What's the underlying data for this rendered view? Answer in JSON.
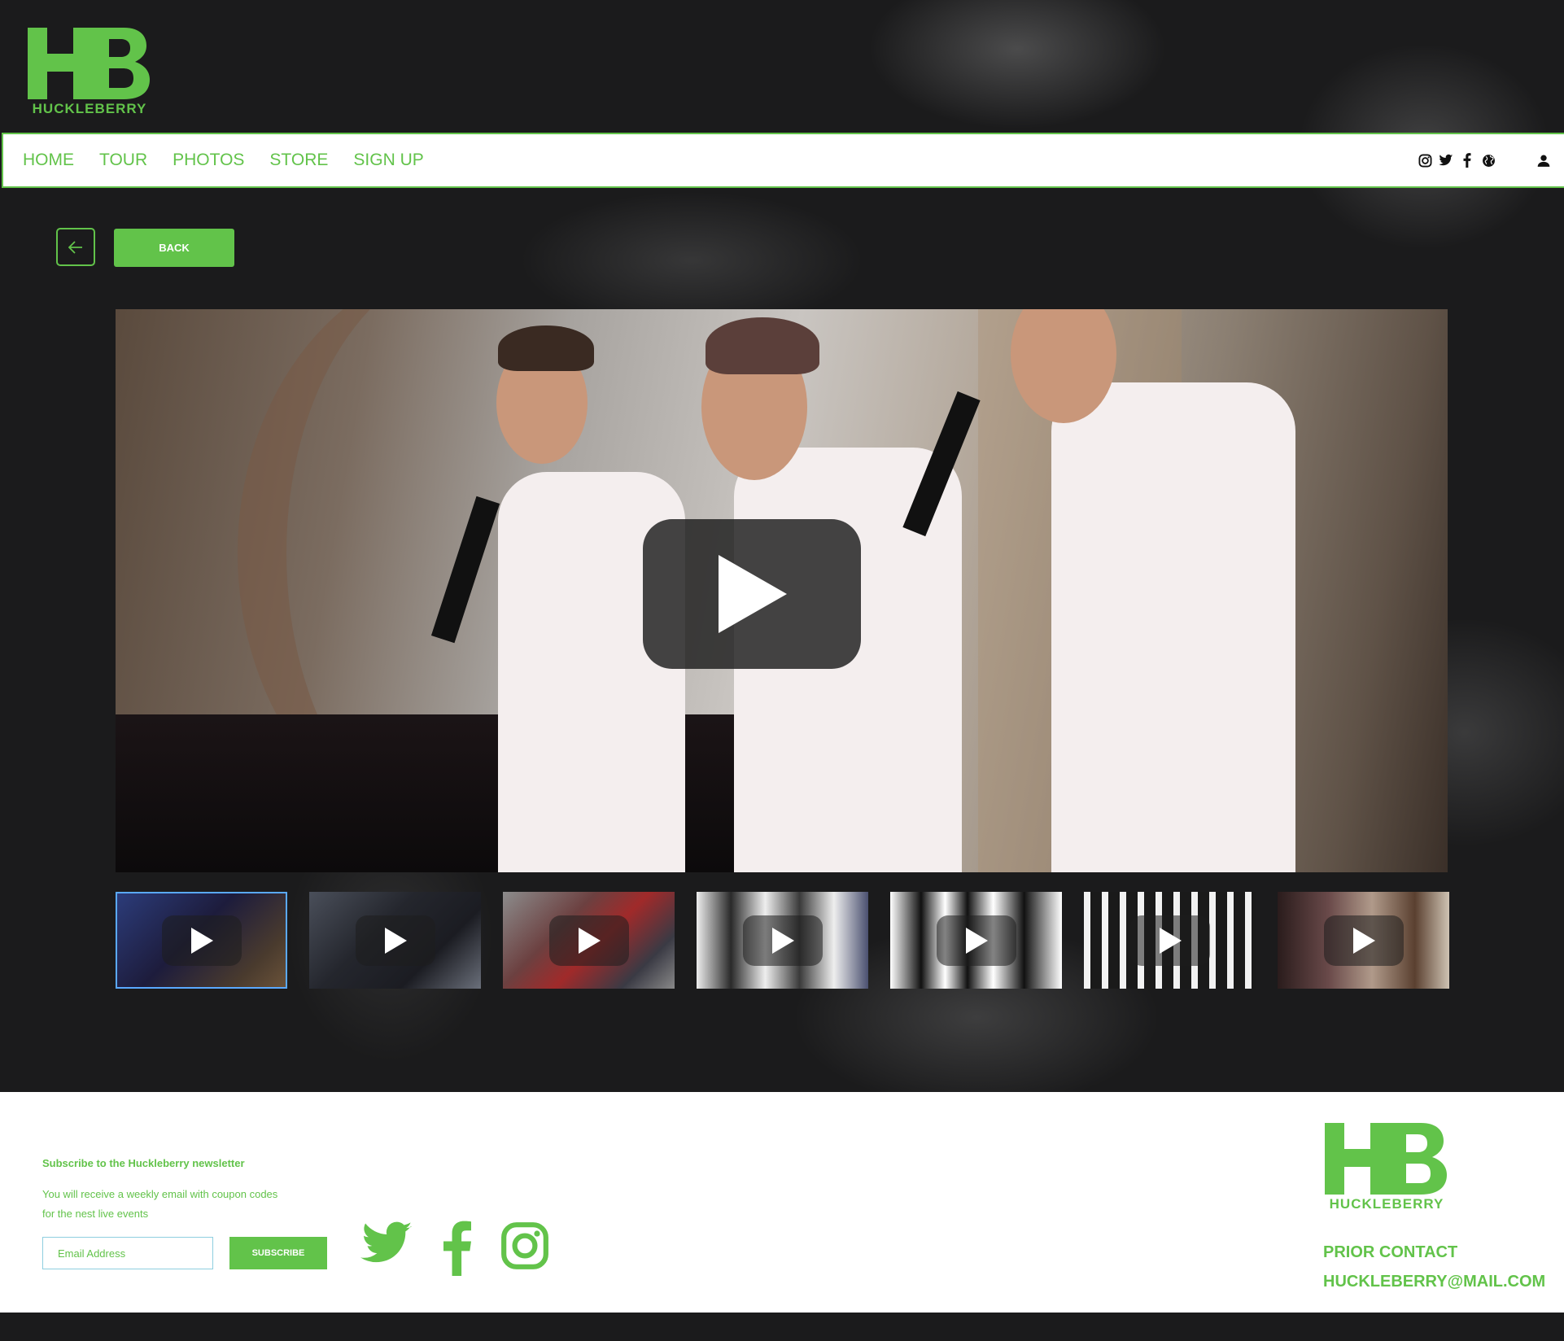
{
  "brand": {
    "initials": "HB",
    "name": "HUCKLEBERRY",
    "accent": "#62c34a"
  },
  "nav": {
    "links": [
      "HOME",
      "TOUR",
      "PHOTOS",
      "STORE",
      "SIGN UP"
    ],
    "icons": [
      "instagram-icon",
      "twitter-icon",
      "facebook-icon",
      "globe-icon",
      "user-icon"
    ]
  },
  "back": {
    "label": "BACK",
    "icon": "arrow-left-icon"
  },
  "video": {
    "play_icon": "play-icon",
    "thumbnail_count": 7,
    "selected_thumbnail": 1
  },
  "footer": {
    "newsletter_title": "Subscribe to the Huckleberry newsletter",
    "newsletter_desc_line1": "You will receive a weekly email with coupon codes",
    "newsletter_desc_line2": "for the nest live events",
    "email_placeholder": "Email Address",
    "subscribe_label": "SUBSCRIBE",
    "social_icons": [
      "twitter-icon",
      "facebook-icon",
      "instagram-icon"
    ],
    "contact_line1": "PRIOR CONTACT",
    "contact_line2": "HUCKLEBERRY@MAIL.COM"
  }
}
